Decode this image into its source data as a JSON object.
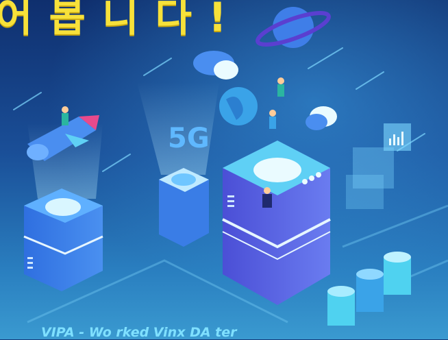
{
  "headline": "어 봅 니 다 !",
  "caption": "VIPA - Wo                 rked    Vinx DA ter",
  "badge_5g": "5G",
  "colors": {
    "sky_top": "#0f2f6e",
    "sky_bottom": "#3a9ad0",
    "headline": "#f7e13a",
    "server_blue": "#3f7ee8",
    "server_cyan": "#5fd0f5",
    "accent_purple": "#5a3fd0"
  },
  "icons": [
    "rocket-icon",
    "planet-icon",
    "cloud-icon",
    "globe-icon",
    "chart-icon",
    "database-icon"
  ]
}
